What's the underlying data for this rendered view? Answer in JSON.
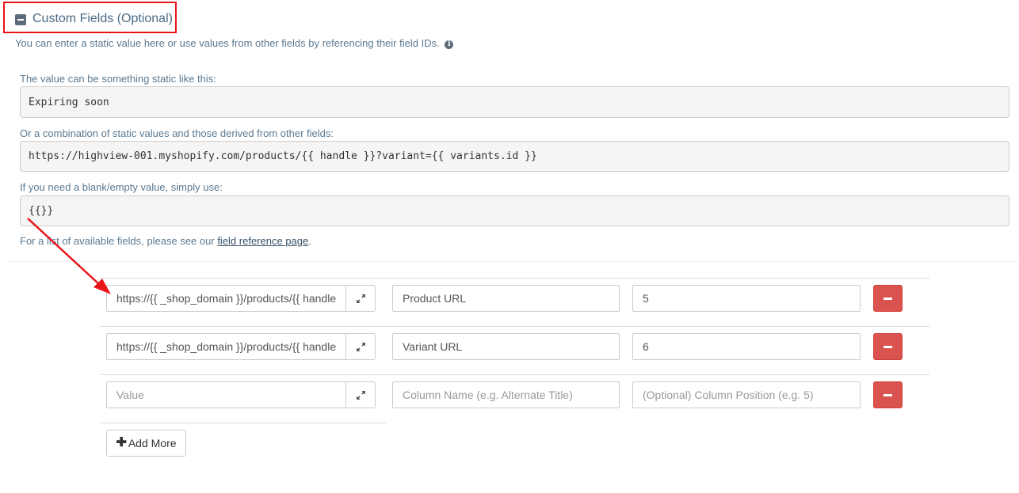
{
  "section": {
    "title": "Custom Fields (Optional)",
    "subtitle": "You can enter a static value here or use values from other fields by referencing their field IDs.",
    "info_icon": "i"
  },
  "examples": [
    {
      "label": "The value can be something static like this:",
      "code": "Expiring soon"
    },
    {
      "label": "Or a combination of static values and those derived from other fields:",
      "code": "https://highview-001.myshopify.com/products/{{ handle }}?variant={{ variants.id }}"
    },
    {
      "label": "If you need a blank/empty value, simply use:",
      "code": "{{}}"
    }
  ],
  "reference": {
    "prefix": "For a list of available fields, please see our ",
    "link": "field reference page",
    "suffix": "."
  },
  "rows": [
    {
      "value": "https://{{ _shop_domain }}/products/{{ handle",
      "name": "Product URL",
      "position": "5"
    },
    {
      "value": "https://{{ _shop_domain }}/products/{{ handle",
      "name": "Variant URL",
      "position": "6"
    },
    {
      "value": "",
      "name": "",
      "position": ""
    }
  ],
  "placeholders": {
    "value": "Value",
    "name": "Column Name (e.g. Alternate Title)",
    "position": "(Optional) Column Position (e.g. 5)"
  },
  "add_more": {
    "icon": "✚",
    "label": "Add More"
  },
  "colors": {
    "highlight": "#e8141a",
    "danger": "#d9534f",
    "label": "#5b7a92"
  }
}
